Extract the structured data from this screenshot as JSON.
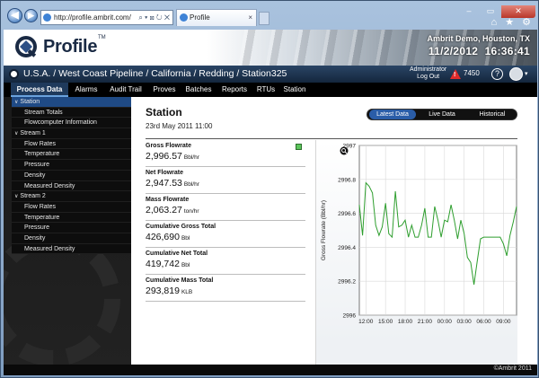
{
  "browser": {
    "url": "http://profile.ambrit.com/",
    "tab_title": "Profile",
    "tab_close": "×",
    "back_glyph": "◀",
    "forward_glyph": "▶",
    "addr_tools": "⌕ ▾ ⊠ ↻ ✕",
    "win_min": "–",
    "win_max": "▭",
    "win_close": "✕",
    "home_glyph": "⌂",
    "star_glyph": "★",
    "gear_glyph": "⚙"
  },
  "header": {
    "logo_text": "Profile",
    "logo_tm": "TM",
    "user_location": "Ambrit Demo, Houston, TX",
    "date": "11/2/2012",
    "time": "16:36:41"
  },
  "crumbbar": {
    "breadcrumb": "U.S.A. / West Coast Pipeline / California / Redding / Station325",
    "admin_line1": "Administrator",
    "admin_line2": "Log Out",
    "warn_glyph": "!",
    "alarm_count": "7450",
    "help_glyph": "?",
    "caret_glyph": "▾"
  },
  "nav": {
    "tabs": [
      "Process Data",
      "Alarms",
      "Audit Trail",
      "Proves",
      "Batches",
      "Reports",
      "RTUs",
      "Station"
    ]
  },
  "sidebar": {
    "rows": [
      "Station",
      "Stream Totals",
      "Flowcomputer Information",
      "Stream 1",
      "Flow Rates",
      "Temperature",
      "Pressure",
      "Density",
      "Measured Density",
      "Stream 2",
      "Flow Rates",
      "Temperature",
      "Pressure",
      "Density",
      "Measured Density"
    ]
  },
  "station": {
    "title": "Station",
    "date": "23rd May 2011 11:00",
    "view_options": [
      "Latest Data",
      "Live Data",
      "Historical"
    ],
    "metrics": [
      {
        "label": "Gross Flowrate",
        "value": "2,996.57",
        "unit": "Bbl/hr"
      },
      {
        "label": "Net Flowrate",
        "value": "2,947.53",
        "unit": "Bbl/hr"
      },
      {
        "label": "Mass Flowrate",
        "value": "2,063.27",
        "unit": "ton/hr"
      },
      {
        "label": "Cumulative Gross Total",
        "value": "426,690",
        "unit": "Bbl"
      },
      {
        "label": "Cumulative Net Total",
        "value": "419,742",
        "unit": "Bbl"
      },
      {
        "label": "Cumulative Mass Total",
        "value": "293,819",
        "unit": "KLB"
      }
    ]
  },
  "chart_data": {
    "type": "line",
    "title": "",
    "xlabel": "",
    "ylabel": "Gross Flowrate (Bbl/hr)",
    "ylim": [
      2996,
      2997
    ],
    "y_ticks": [
      "2996",
      "2996.2",
      "2996.4",
      "2996.6",
      "2996.8",
      "2997"
    ],
    "x_ticks": [
      "12:00",
      "15:00",
      "18:00",
      "21:00",
      "00:00",
      "03:00",
      "06:00",
      "09:00"
    ],
    "x_hours": [
      11,
      11.5,
      12,
      12.5,
      13,
      13.5,
      14,
      14.5,
      15,
      15.5,
      16,
      16.5,
      17,
      17.5,
      18,
      18.5,
      19,
      19.5,
      20,
      20.5,
      21,
      21.5,
      22,
      22.5,
      23,
      23.5,
      24,
      24.5,
      25,
      25.5,
      26,
      26.5,
      27,
      27.5,
      28,
      28.5,
      29,
      29.5,
      30,
      30.5,
      31,
      31.5,
      32,
      32.5,
      33,
      33.5,
      34,
      34.5,
      35
    ],
    "series": [
      {
        "color": "#2e9e2e",
        "values": [
          2996.65,
          2996.47,
          2996.78,
          2996.76,
          2996.72,
          2996.53,
          2996.47,
          2996.52,
          2996.66,
          2996.48,
          2996.46,
          2996.73,
          2996.52,
          2996.53,
          2996.56,
          2996.46,
          2996.53,
          2996.46,
          2996.46,
          2996.53,
          2996.63,
          2996.46,
          2996.46,
          2996.64,
          2996.56,
          2996.46,
          2996.56,
          2996.55,
          2996.65,
          2996.56,
          2996.45,
          2996.56,
          2996.48,
          2996.34,
          2996.31,
          2996.18,
          2996.32,
          2996.45,
          2996.46,
          2996.46,
          2996.46,
          2996.46,
          2996.46,
          2996.46,
          2996.42,
          2996.35,
          2996.47,
          2996.55,
          2996.64
        ]
      }
    ],
    "grid": true,
    "legend": "none",
    "zoom_icon": "magnifier"
  },
  "footer": {
    "copyright": "©Ambrit 2011"
  }
}
